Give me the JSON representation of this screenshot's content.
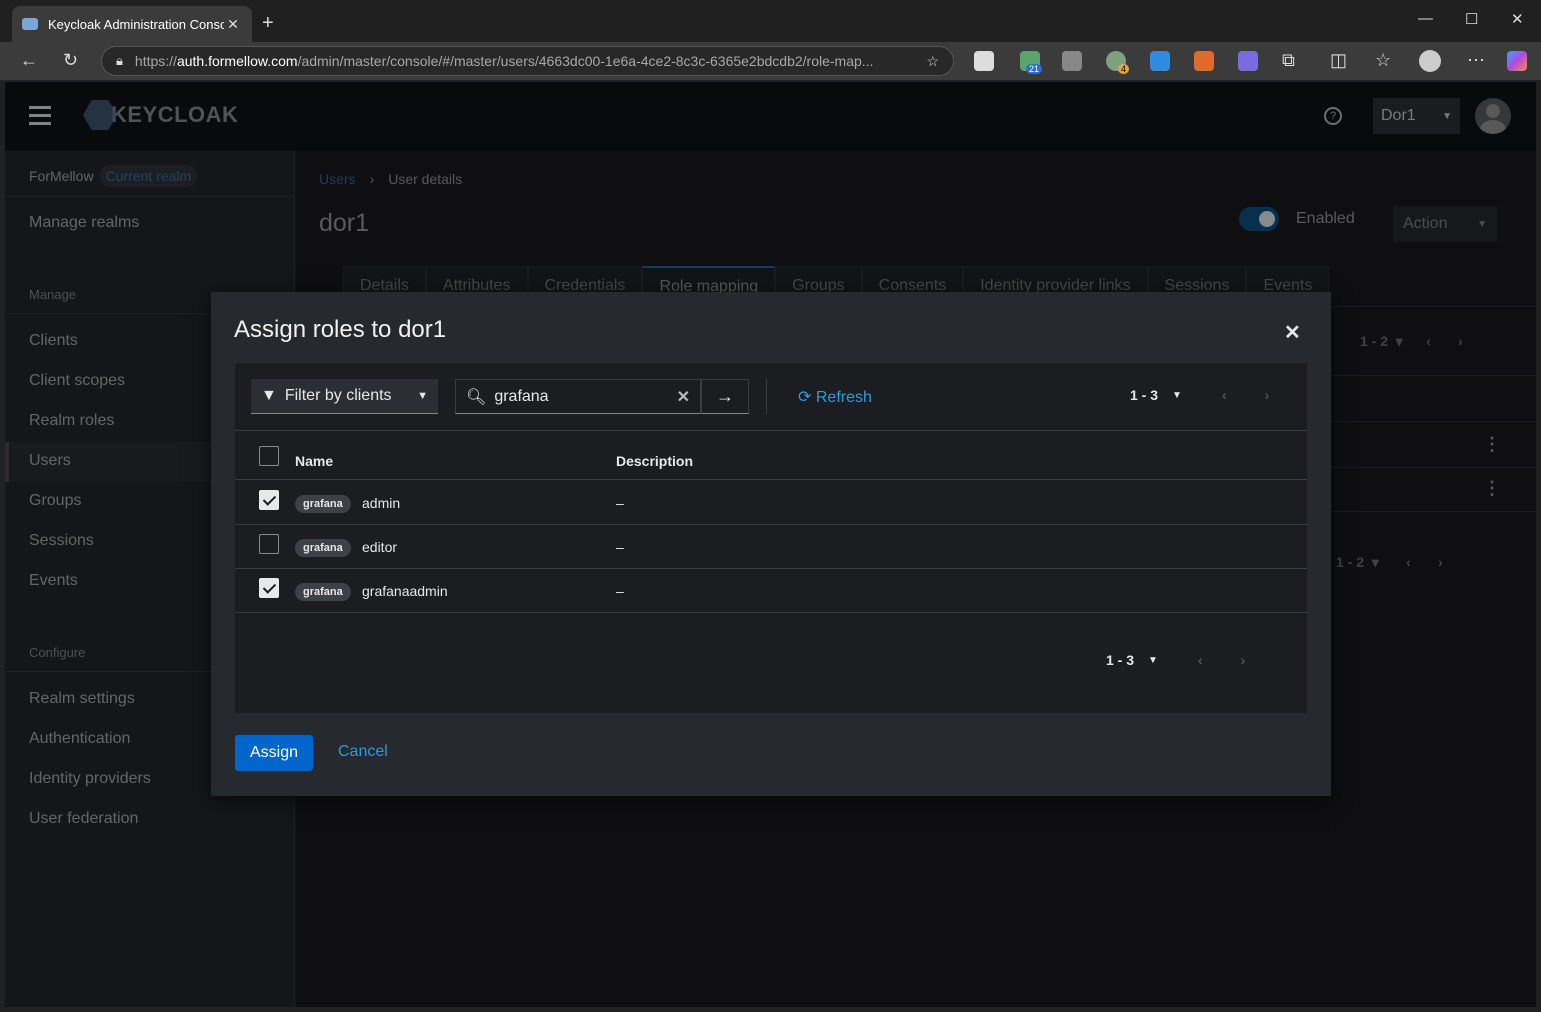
{
  "browser": {
    "tab_title": "Keycloak Administration Console",
    "url_prefix": "https://",
    "url_host": "auth.formellow.com",
    "url_path": "/admin/master/console/#/master/users/4663dc00-1e6a-4ce2-8c3c-6365e2bdcdb2/role-map...",
    "ext_badge_1": "21",
    "ext_badge_2": "4"
  },
  "masthead": {
    "logo_text": "KEYCLOAK",
    "user_menu_label": "Dor1"
  },
  "sidebar": {
    "realm_name": "ForMellow",
    "realm_badge": "Current realm",
    "manage_realms": "Manage realms",
    "manage_section": "Manage",
    "manage_items": [
      "Clients",
      "Client scopes",
      "Realm roles",
      "Users",
      "Groups",
      "Sessions",
      "Events"
    ],
    "configure_section": "Configure",
    "configure_items": [
      "Realm settings",
      "Authentication",
      "Identity providers",
      "User federation"
    ]
  },
  "page": {
    "breadcrumb_link": "Users",
    "breadcrumb_current": "User details",
    "title": "dor1",
    "enabled_label": "Enabled",
    "action_label": "Action",
    "tabs": [
      "Details",
      "Attributes",
      "Credentials",
      "Role mapping",
      "Groups",
      "Consents",
      "Identity provider links",
      "Sessions",
      "Events"
    ],
    "bg_pager": "1 - 2"
  },
  "modal": {
    "title": "Assign roles to dor1",
    "filter_label": "Filter by clients",
    "search_value": "grafana",
    "refresh_label": "Refresh",
    "pager_label": "1 - 3",
    "col_name": "Name",
    "col_description": "Description",
    "rows": [
      {
        "client": "grafana",
        "name": "admin",
        "description": "–",
        "checked": true
      },
      {
        "client": "grafana",
        "name": "editor",
        "description": "–",
        "checked": false
      },
      {
        "client": "grafana",
        "name": "grafanaadmin",
        "description": "–",
        "checked": true
      }
    ],
    "assign_label": "Assign",
    "cancel_label": "Cancel"
  }
}
